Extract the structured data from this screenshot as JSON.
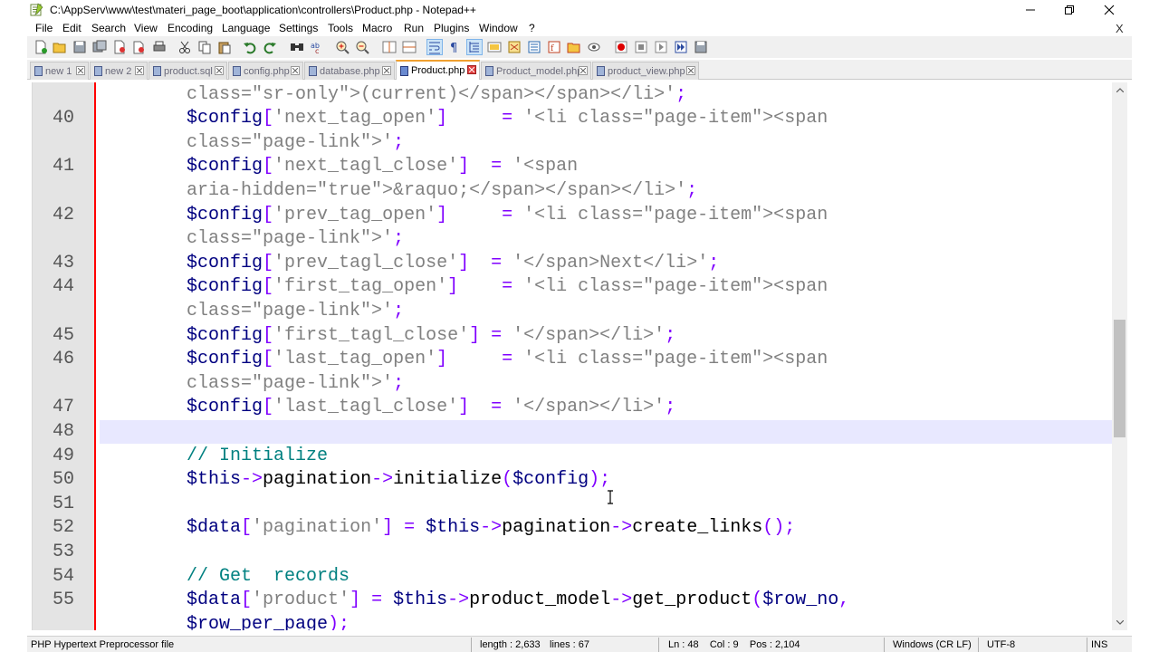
{
  "window": {
    "title": "C:\\AppServ\\www\\test\\materi_page_boot\\application\\controllers\\Product.php - Notepad++"
  },
  "menu": [
    "File",
    "Edit",
    "Search",
    "View",
    "Encoding",
    "Language",
    "Settings",
    "Tools",
    "Macro",
    "Run",
    "Plugins",
    "Window",
    "?"
  ],
  "menu_close": "X",
  "tabs": [
    {
      "label": "new 1",
      "active": false
    },
    {
      "label": "new 2",
      "active": false
    },
    {
      "label": "product.sql",
      "active": false
    },
    {
      "label": "config.php",
      "active": false
    },
    {
      "label": "database.php",
      "active": false
    },
    {
      "label": "Product.php",
      "active": true
    },
    {
      "label": "Product_model.php",
      "active": false
    },
    {
      "label": "product_view.php",
      "active": false
    }
  ],
  "editor": {
    "line_numbers": [
      "",
      "40",
      "",
      "41",
      "",
      "42",
      "",
      "43",
      "44",
      "",
      "45",
      "46",
      "",
      "47",
      "48",
      "49",
      "50",
      "51",
      "52",
      "53",
      "54",
      "55",
      ""
    ],
    "current_row": 14,
    "lines": [
      [
        {
          "t": "pl",
          "v": "        "
        },
        {
          "t": "str",
          "v": "class=\"sr-only\">(current)</span></span></li>'"
        },
        {
          "t": "op",
          "v": ";"
        }
      ],
      [
        {
          "t": "pl",
          "v": "        "
        },
        {
          "t": "var",
          "v": "$config"
        },
        {
          "t": "op",
          "v": "["
        },
        {
          "t": "str",
          "v": "'next_tag_open'"
        },
        {
          "t": "op",
          "v": "]"
        },
        {
          "t": "pl",
          "v": "     "
        },
        {
          "t": "op",
          "v": "="
        },
        {
          "t": "pl",
          "v": " "
        },
        {
          "t": "str",
          "v": "'<li class=\"page-item\"><span"
        }
      ],
      [
        {
          "t": "pl",
          "v": "        "
        },
        {
          "t": "str",
          "v": "class=\"page-link\">'"
        },
        {
          "t": "op",
          "v": ";"
        }
      ],
      [
        {
          "t": "pl",
          "v": "        "
        },
        {
          "t": "var",
          "v": "$config"
        },
        {
          "t": "op",
          "v": "["
        },
        {
          "t": "str",
          "v": "'next_tagl_close'"
        },
        {
          "t": "op",
          "v": "]"
        },
        {
          "t": "pl",
          "v": "  "
        },
        {
          "t": "op",
          "v": "="
        },
        {
          "t": "pl",
          "v": " "
        },
        {
          "t": "str",
          "v": "'<span"
        }
      ],
      [
        {
          "t": "pl",
          "v": "        "
        },
        {
          "t": "str",
          "v": "aria-hidden=\"true\">&raquo;</span></span></li>'"
        },
        {
          "t": "op",
          "v": ";"
        }
      ],
      [
        {
          "t": "pl",
          "v": "        "
        },
        {
          "t": "var",
          "v": "$config"
        },
        {
          "t": "op",
          "v": "["
        },
        {
          "t": "str",
          "v": "'prev_tag_open'"
        },
        {
          "t": "op",
          "v": "]"
        },
        {
          "t": "pl",
          "v": "     "
        },
        {
          "t": "op",
          "v": "="
        },
        {
          "t": "pl",
          "v": " "
        },
        {
          "t": "str",
          "v": "'<li class=\"page-item\"><span"
        }
      ],
      [
        {
          "t": "pl",
          "v": "        "
        },
        {
          "t": "str",
          "v": "class=\"page-link\">'"
        },
        {
          "t": "op",
          "v": ";"
        }
      ],
      [
        {
          "t": "pl",
          "v": "        "
        },
        {
          "t": "var",
          "v": "$config"
        },
        {
          "t": "op",
          "v": "["
        },
        {
          "t": "str",
          "v": "'prev_tagl_close'"
        },
        {
          "t": "op",
          "v": "]"
        },
        {
          "t": "pl",
          "v": "  "
        },
        {
          "t": "op",
          "v": "="
        },
        {
          "t": "pl",
          "v": " "
        },
        {
          "t": "str",
          "v": "'</span>Next</li>'"
        },
        {
          "t": "op",
          "v": ";"
        }
      ],
      [
        {
          "t": "pl",
          "v": "        "
        },
        {
          "t": "var",
          "v": "$config"
        },
        {
          "t": "op",
          "v": "["
        },
        {
          "t": "str",
          "v": "'first_tag_open'"
        },
        {
          "t": "op",
          "v": "]"
        },
        {
          "t": "pl",
          "v": "    "
        },
        {
          "t": "op",
          "v": "="
        },
        {
          "t": "pl",
          "v": " "
        },
        {
          "t": "str",
          "v": "'<li class=\"page-item\"><span"
        }
      ],
      [
        {
          "t": "pl",
          "v": "        "
        },
        {
          "t": "str",
          "v": "class=\"page-link\">'"
        },
        {
          "t": "op",
          "v": ";"
        }
      ],
      [
        {
          "t": "pl",
          "v": "        "
        },
        {
          "t": "var",
          "v": "$config"
        },
        {
          "t": "op",
          "v": "["
        },
        {
          "t": "str",
          "v": "'first_tagl_close'"
        },
        {
          "t": "op",
          "v": "]"
        },
        {
          "t": "pl",
          "v": " "
        },
        {
          "t": "op",
          "v": "="
        },
        {
          "t": "pl",
          "v": " "
        },
        {
          "t": "str",
          "v": "'</span></li>'"
        },
        {
          "t": "op",
          "v": ";"
        }
      ],
      [
        {
          "t": "pl",
          "v": "        "
        },
        {
          "t": "var",
          "v": "$config"
        },
        {
          "t": "op",
          "v": "["
        },
        {
          "t": "str",
          "v": "'last_tag_open'"
        },
        {
          "t": "op",
          "v": "]"
        },
        {
          "t": "pl",
          "v": "     "
        },
        {
          "t": "op",
          "v": "="
        },
        {
          "t": "pl",
          "v": " "
        },
        {
          "t": "str",
          "v": "'<li class=\"page-item\"><span"
        }
      ],
      [
        {
          "t": "pl",
          "v": "        "
        },
        {
          "t": "str",
          "v": "class=\"page-link\">'"
        },
        {
          "t": "op",
          "v": ";"
        }
      ],
      [
        {
          "t": "pl",
          "v": "        "
        },
        {
          "t": "var",
          "v": "$config"
        },
        {
          "t": "op",
          "v": "["
        },
        {
          "t": "str",
          "v": "'last_tagl_close'"
        },
        {
          "t": "op",
          "v": "]"
        },
        {
          "t": "pl",
          "v": "  "
        },
        {
          "t": "op",
          "v": "="
        },
        {
          "t": "pl",
          "v": " "
        },
        {
          "t": "str",
          "v": "'</span></li>'"
        },
        {
          "t": "op",
          "v": ";"
        }
      ],
      [
        {
          "t": "pl",
          "v": ""
        }
      ],
      [
        {
          "t": "pl",
          "v": "        "
        },
        {
          "t": "cm",
          "v": "// Initialize"
        }
      ],
      [
        {
          "t": "pl",
          "v": "        "
        },
        {
          "t": "var",
          "v": "$this"
        },
        {
          "t": "op",
          "v": "->"
        },
        {
          "t": "fn",
          "v": "pagination"
        },
        {
          "t": "op",
          "v": "->"
        },
        {
          "t": "fn",
          "v": "initialize"
        },
        {
          "t": "op",
          "v": "("
        },
        {
          "t": "var",
          "v": "$config"
        },
        {
          "t": "op",
          "v": ");"
        }
      ],
      [
        {
          "t": "pl",
          "v": ""
        }
      ],
      [
        {
          "t": "pl",
          "v": "        "
        },
        {
          "t": "var",
          "v": "$data"
        },
        {
          "t": "op",
          "v": "["
        },
        {
          "t": "str",
          "v": "'pagination'"
        },
        {
          "t": "op",
          "v": "]"
        },
        {
          "t": "pl",
          "v": " "
        },
        {
          "t": "op",
          "v": "="
        },
        {
          "t": "pl",
          "v": " "
        },
        {
          "t": "var",
          "v": "$this"
        },
        {
          "t": "op",
          "v": "->"
        },
        {
          "t": "fn",
          "v": "pagination"
        },
        {
          "t": "op",
          "v": "->"
        },
        {
          "t": "fn",
          "v": "create_links"
        },
        {
          "t": "op",
          "v": "();"
        }
      ],
      [
        {
          "t": "pl",
          "v": ""
        }
      ],
      [
        {
          "t": "pl",
          "v": "        "
        },
        {
          "t": "cm",
          "v": "// Get  records"
        }
      ],
      [
        {
          "t": "pl",
          "v": "        "
        },
        {
          "t": "var",
          "v": "$data"
        },
        {
          "t": "op",
          "v": "["
        },
        {
          "t": "str",
          "v": "'product'"
        },
        {
          "t": "op",
          "v": "]"
        },
        {
          "t": "pl",
          "v": " "
        },
        {
          "t": "op",
          "v": "="
        },
        {
          "t": "pl",
          "v": " "
        },
        {
          "t": "var",
          "v": "$this"
        },
        {
          "t": "op",
          "v": "->"
        },
        {
          "t": "fn",
          "v": "product_model"
        },
        {
          "t": "op",
          "v": "->"
        },
        {
          "t": "fn",
          "v": "get_product"
        },
        {
          "t": "op",
          "v": "("
        },
        {
          "t": "var",
          "v": "$row_no"
        },
        {
          "t": "op",
          "v": ","
        }
      ],
      [
        {
          "t": "pl",
          "v": "        "
        },
        {
          "t": "var",
          "v": "$row_per_page"
        },
        {
          "t": "op",
          "v": ");"
        }
      ]
    ]
  },
  "status": {
    "file_type": "PHP Hypertext Preprocessor file",
    "length": "length : 2,633",
    "lines": "lines : 67",
    "position": "Ln : 48    Col : 9    Pos : 2,104",
    "eol": "Windows (CR LF)",
    "encoding": "UTF-8",
    "mode": "INS"
  },
  "colors": {
    "variable": "#000080",
    "string": "#808080",
    "operator": "#8000ff",
    "comment": "#008080",
    "current_line": "#e8e8ff",
    "active_tab_accent": "#f0a030"
  }
}
